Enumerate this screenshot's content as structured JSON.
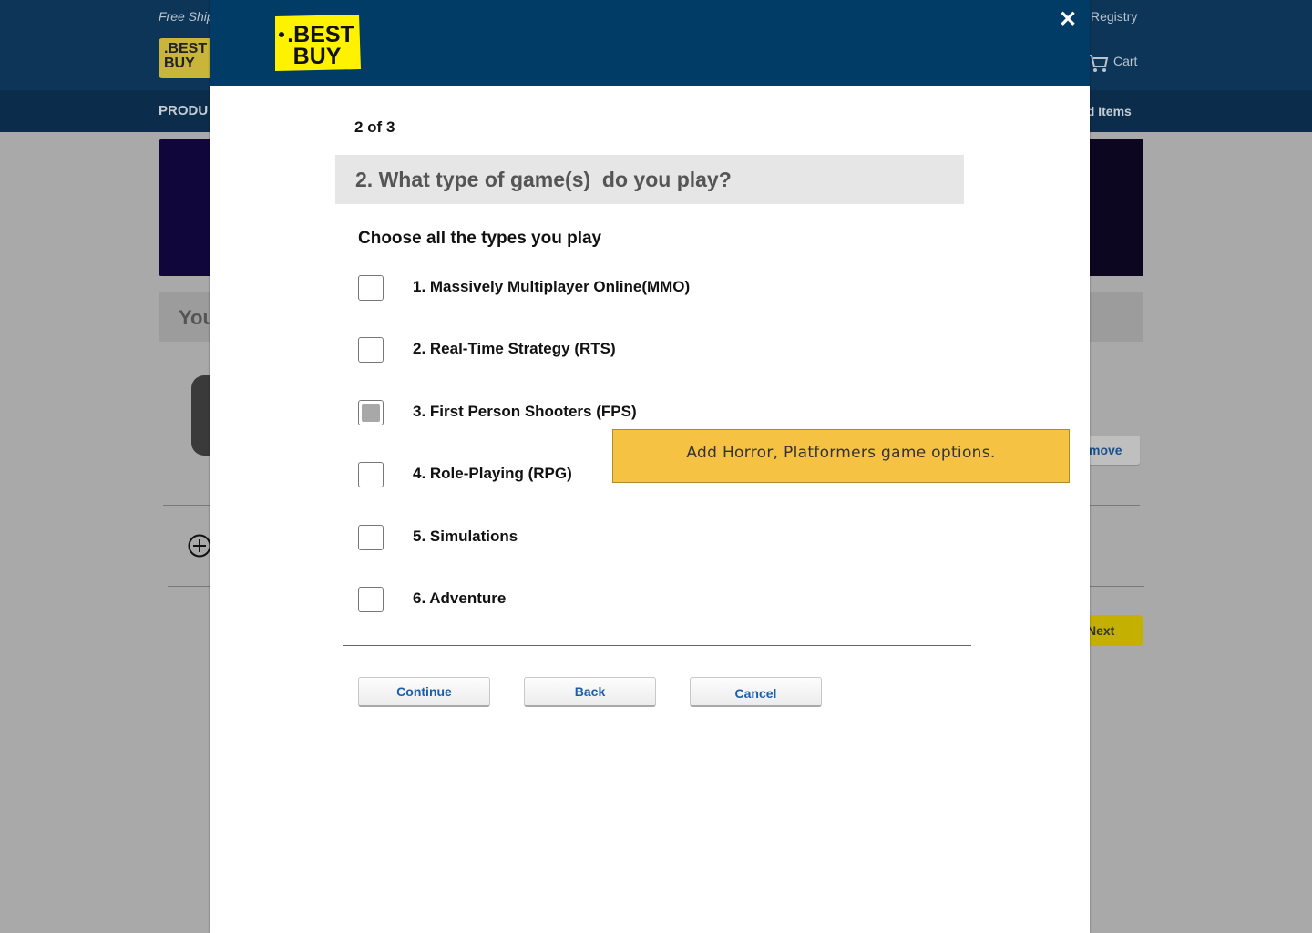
{
  "background": {
    "free_shipping": "Free Ship",
    "registry": "Registry",
    "cart": "Cart",
    "products_nav": "PRODU",
    "saved_items": "ed Items",
    "section_title": "You",
    "remove_label": "move",
    "next_label": "Next",
    "logo_text": ".BEST BUY"
  },
  "modal": {
    "logo_text_1": ".BEST",
    "logo_text_2": "BUY",
    "close_label": "✕",
    "step": "2 of 3",
    "question": "2. What type of game(s)  do you play?",
    "instruction": "Choose all the types you play",
    "options": [
      {
        "label": "1. Massively Multiplayer Online(MMO)",
        "checked": false
      },
      {
        "label": "2. Real-Time Strategy (RTS)",
        "checked": false
      },
      {
        "label": "3. First Person Shooters (FPS)",
        "checked": true
      },
      {
        "label": "4. Role-Playing (RPG)",
        "checked": false
      },
      {
        "label": "5. Simulations",
        "checked": false
      },
      {
        "label": "6. Adventure",
        "checked": false
      }
    ],
    "tooltip": "Add Horror, Platformers game options.",
    "buttons": {
      "continue": "Continue",
      "back": "Back",
      "cancel": "Cancel"
    }
  },
  "colors": {
    "header_blue": "#003c66",
    "logo_yellow": "#fff200",
    "tooltip_yellow": "#f5c244",
    "button_text_blue": "#1b5eab"
  }
}
